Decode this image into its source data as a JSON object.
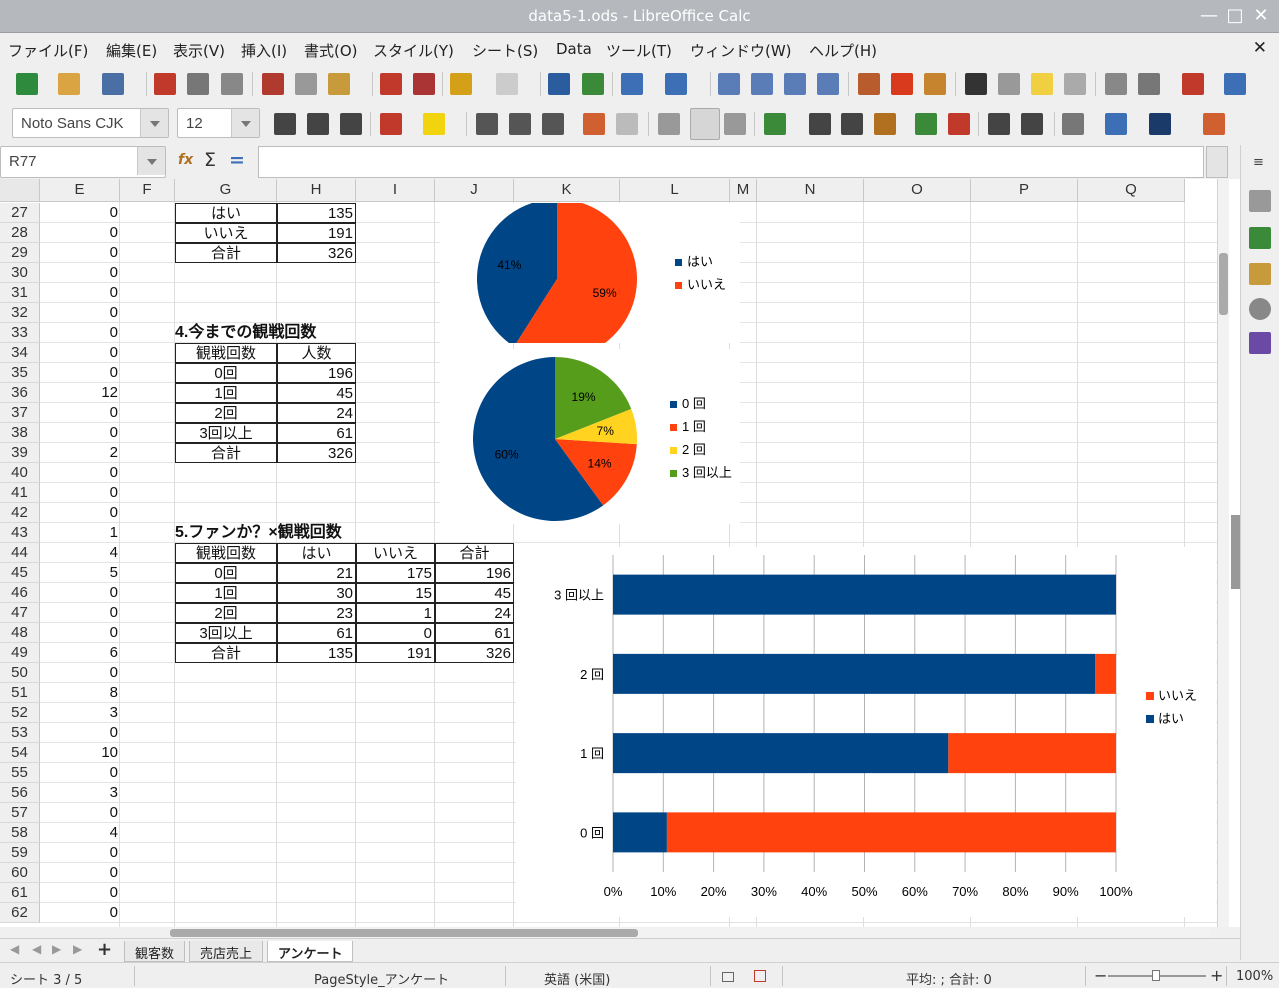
{
  "window": {
    "title": "data5-1.ods - LibreOffice Calc"
  },
  "menu": [
    "ファイル(F)",
    "編集(E)",
    "表示(V)",
    "挿入(I)",
    "書式(O)",
    "スタイル(Y)",
    "シート(S)",
    "Data",
    "ツール(T)",
    "ウィンドウ(W)",
    "ヘルプ(H)"
  ],
  "toolbar": {
    "font_name": "Noto Sans CJK",
    "font_size": "12"
  },
  "formula_bar": {
    "name_box": "R77",
    "content": ""
  },
  "columns": [
    "E",
    "F",
    "G",
    "H",
    "I",
    "J",
    "K",
    "L",
    "M",
    "N",
    "O",
    "P",
    "Q"
  ],
  "rows": [
    "27",
    "28",
    "29",
    "30",
    "31",
    "32",
    "33",
    "34",
    "35",
    "36",
    "37",
    "38",
    "39",
    "40",
    "41",
    "42",
    "43",
    "44",
    "45",
    "46",
    "47",
    "48",
    "49",
    "50",
    "51",
    "52",
    "53",
    "54",
    "55",
    "56",
    "57",
    "58",
    "59",
    "60",
    "61",
    "62"
  ],
  "col_e_values": [
    "0",
    "0",
    "0",
    "0",
    "0",
    "0",
    "0",
    "0",
    "0",
    "12",
    "0",
    "0",
    "2",
    "0",
    "0",
    "0",
    "1",
    "4",
    "5",
    "0",
    "0",
    "0",
    "6",
    "0",
    "8",
    "3",
    "0",
    "10",
    "0",
    "3",
    "0",
    "4",
    "0",
    "0",
    "0",
    "0"
  ],
  "table1": {
    "rows": [
      [
        "はい",
        "135"
      ],
      [
        "いいえ",
        "191"
      ],
      [
        "合計",
        "326"
      ]
    ]
  },
  "table2": {
    "heading": "4.今までの観戦回数",
    "headers": [
      "観戦回数",
      "人数"
    ],
    "rows": [
      [
        "0回",
        "196"
      ],
      [
        "1回",
        "45"
      ],
      [
        "2回",
        "24"
      ],
      [
        "3回以上",
        "61"
      ],
      [
        "合計",
        "326"
      ]
    ]
  },
  "table3": {
    "heading": "5.ファンか？×観戦回数",
    "headers": [
      "観戦回数",
      "はい",
      "いいえ",
      "合計"
    ],
    "rows": [
      [
        "0回",
        "21",
        "175",
        "196"
      ],
      [
        "1回",
        "30",
        "15",
        "45"
      ],
      [
        "2回",
        "23",
        "1",
        "24"
      ],
      [
        "3回以上",
        "61",
        "0",
        "61"
      ],
      [
        "合計",
        "135",
        "191",
        "326"
      ]
    ]
  },
  "chart_data": [
    {
      "type": "pie",
      "labels": [
        "はい",
        "いいえ"
      ],
      "values": [
        41,
        59
      ],
      "data_labels": [
        "41%",
        "59%"
      ],
      "colors": [
        "#004586",
        "#ff420e"
      ],
      "legend": "right"
    },
    {
      "type": "pie",
      "labels": [
        "0 回",
        "1 回",
        "2 回",
        "3 回以上"
      ],
      "values": [
        60,
        14,
        7,
        19
      ],
      "data_labels": [
        "60%",
        "14%",
        "7%",
        "19%"
      ],
      "colors": [
        "#004586",
        "#ff420e",
        "#ffd320",
        "#579d1c"
      ],
      "legend": "right"
    },
    {
      "type": "bar",
      "orientation": "horizontal",
      "stacked": "percent",
      "categories": [
        "0 回",
        "1 回",
        "2 回",
        "3 回以上"
      ],
      "series": [
        {
          "name": "はい",
          "values": [
            21,
            30,
            23,
            61
          ],
          "color": "#004586"
        },
        {
          "name": "いいえ",
          "values": [
            175,
            15,
            1,
            0
          ],
          "color": "#ff420e"
        }
      ],
      "xticks": [
        "0%",
        "10%",
        "20%",
        "30%",
        "40%",
        "50%",
        "60%",
        "70%",
        "80%",
        "90%",
        "100%"
      ],
      "xlim": [
        0,
        100
      ],
      "grid": true,
      "legend": "right"
    }
  ],
  "sheet_tabs": [
    "観客数",
    "売店売上",
    "アンケート"
  ],
  "active_tab": "アンケート",
  "status": {
    "sheet": "シート 3 / 5",
    "page_style": "PageStyle_アンケート",
    "language": "英語 (米国)",
    "summary": "平均: ; 合計: 0",
    "zoom": "100%"
  }
}
